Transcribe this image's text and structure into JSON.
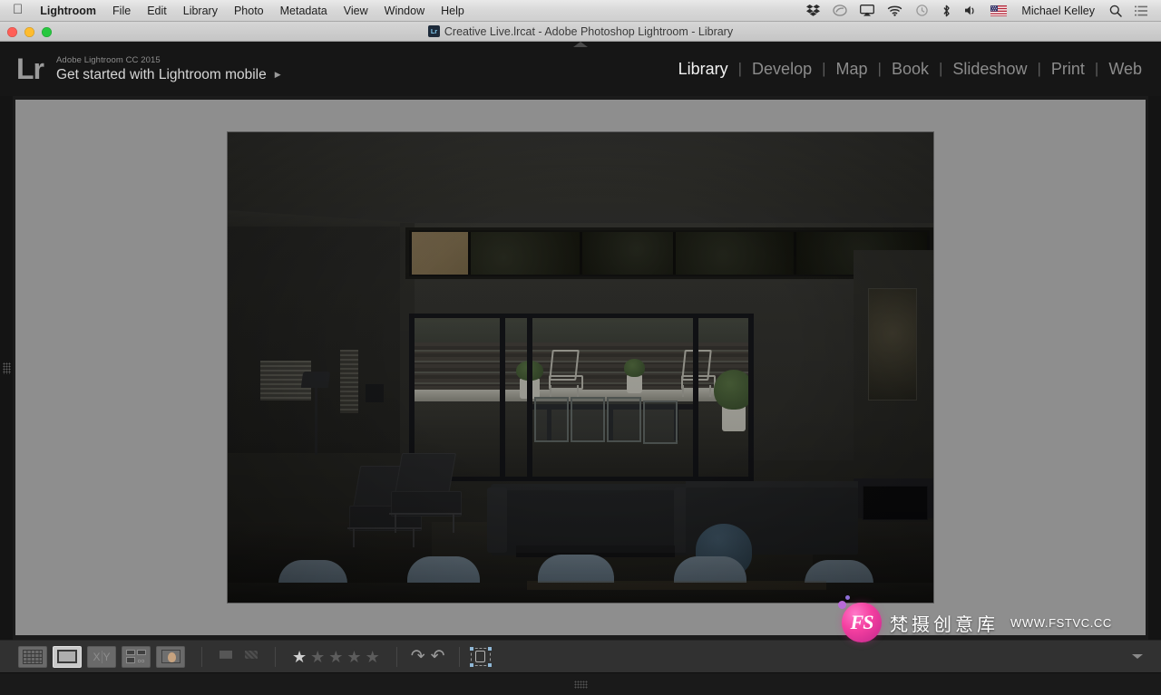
{
  "menubar": {
    "apple_logo": "apple-logo",
    "items": [
      {
        "label": "Lightroom",
        "bold": true
      },
      {
        "label": "File",
        "bold": false
      },
      {
        "label": "Edit",
        "bold": false
      },
      {
        "label": "Library",
        "bold": false
      },
      {
        "label": "Photo",
        "bold": false
      },
      {
        "label": "Metadata",
        "bold": false
      },
      {
        "label": "View",
        "bold": false
      },
      {
        "label": "Window",
        "bold": false
      },
      {
        "label": "Help",
        "bold": false
      }
    ],
    "status_icons": [
      {
        "name": "dropbox-icon",
        "glyph": "❖"
      },
      {
        "name": "creative-cloud-icon",
        "glyph": "◎"
      },
      {
        "name": "airplay-icon",
        "glyph": "▭"
      },
      {
        "name": "wifi-icon",
        "glyph": "◠"
      },
      {
        "name": "time-machine-icon",
        "glyph": "⧖"
      },
      {
        "name": "bluetooth-icon",
        "glyph": "ᛦ"
      },
      {
        "name": "volume-icon",
        "glyph": "◀"
      },
      {
        "name": "input-flag-icon",
        "glyph": "⚑"
      }
    ],
    "user_name": "Michael Kelley",
    "search_icon": "search-icon",
    "notification_icon": "notification-center-icon"
  },
  "titlebar": {
    "app_badge": "Lr",
    "title": "Creative Live.lrcat - Adobe Photoshop Lightroom - Library",
    "traffic_lights": [
      "close",
      "minimize",
      "zoom"
    ]
  },
  "identity": {
    "logo": "Lr",
    "subtitle": "Adobe Lightroom CC 2015",
    "headline": "Get started with Lightroom mobile",
    "arrow": "▶"
  },
  "modules": {
    "separator": "|",
    "items": [
      {
        "label": "Library",
        "active": true
      },
      {
        "label": "Develop",
        "active": false
      },
      {
        "label": "Map",
        "active": false
      },
      {
        "label": "Book",
        "active": false
      },
      {
        "label": "Slideshow",
        "active": false
      },
      {
        "label": "Print",
        "active": false
      },
      {
        "label": "Web",
        "active": false
      }
    ]
  },
  "toolbar": {
    "view_modes": [
      {
        "name": "grid-view-button",
        "icon": "grid-icon",
        "active": false
      },
      {
        "name": "loupe-view-button",
        "icon": "loupe-icon",
        "active": true
      },
      {
        "name": "compare-view-button",
        "icon": "compare-xy-icon",
        "active": false
      },
      {
        "name": "survey-view-button",
        "icon": "survey-icon",
        "active": false
      },
      {
        "name": "people-view-button",
        "icon": "face-icon",
        "active": false
      }
    ],
    "flags": [
      {
        "name": "flag-pick-button",
        "icon": "flag-icon"
      },
      {
        "name": "flag-reject-button",
        "icon": "flag-reject-icon"
      }
    ],
    "rating": {
      "value": 1,
      "max": 5,
      "star_glyph": "★"
    },
    "rotate": [
      {
        "name": "rotate-right-button",
        "glyph": "↷"
      },
      {
        "name": "rotate-left-button",
        "glyph": "↶"
      }
    ],
    "crop_overlay": {
      "name": "crop-overlay-button",
      "icon": "crop-person-icon"
    },
    "expand_arrow": "▼"
  },
  "panels": {
    "top_toggle": "▲",
    "left_toggle": "left-panel-toggle",
    "right_toggle": "right-panel-toggle",
    "bottom_toggle": "filmstrip-toggle"
  },
  "photo": {
    "name": "loupe-photo",
    "description": "Dark underexposed modern interior: living room with sofa, lounge chairs and coffee table, clerestory windows above and large sliding glass doors opening onto a patio with outdoor dining table and two white patio chairs."
  },
  "watermark": {
    "logo_text": "FS",
    "brand_cn": "梵摄创意库",
    "url": "WWW.FSTVC.CC"
  },
  "colors": {
    "menubar_bg": "#d8d8d8",
    "app_bg": "#1b1b1b",
    "stage_bg": "#8e8e8e",
    "toolbar_bg": "#313131",
    "module_active": "#f2f2f2",
    "module_inactive": "#8c8c8c",
    "watermark_pink": "#f43fa0"
  }
}
